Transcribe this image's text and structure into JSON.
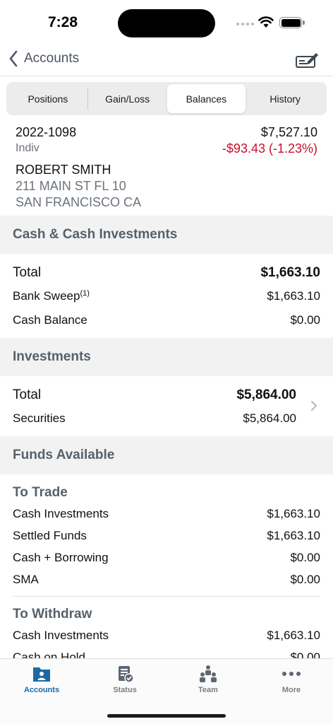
{
  "status": {
    "time": "7:28"
  },
  "nav": {
    "back_label": "Accounts"
  },
  "segments": [
    {
      "label": "Positions",
      "active": false
    },
    {
      "label": "Gain/Loss",
      "active": false
    },
    {
      "label": "Balances",
      "active": true
    },
    {
      "label": "History",
      "active": false
    }
  ],
  "account": {
    "number": "2022-1098",
    "type": "Indiv",
    "value": "$7,527.10",
    "change": "-$93.43 (-1.23%)",
    "owner": "ROBERT SMITH",
    "address_line1": "211 MAIN ST FL 10",
    "address_line2": "SAN FRANCISCO CA"
  },
  "cash": {
    "header": "Cash & Cash Investments",
    "total_label": "Total",
    "total_value": "$1,663.10",
    "bank_sweep_label": "Bank Sweep",
    "bank_sweep_note": "(1)",
    "bank_sweep_value": "$1,663.10",
    "cash_balance_label": "Cash Balance",
    "cash_balance_value": "$0.00"
  },
  "investments": {
    "header": "Investments",
    "total_label": "Total",
    "total_value": "$5,864.00",
    "securities_label": "Securities",
    "securities_value": "$5,864.00"
  },
  "funds": {
    "header": "Funds Available",
    "to_trade": {
      "title": "To Trade",
      "rows": [
        {
          "label": "Cash Investments",
          "value": "$1,663.10"
        },
        {
          "label": "Settled Funds",
          "value": "$1,663.10"
        },
        {
          "label": "Cash + Borrowing",
          "value": "$0.00"
        },
        {
          "label": "SMA",
          "value": "$0.00"
        }
      ]
    },
    "to_withdraw": {
      "title": "To Withdraw",
      "rows": [
        {
          "label": "Cash Investments",
          "value": "$1,663.10"
        },
        {
          "label": "Cash on Hold",
          "value": "$0.00"
        }
      ]
    }
  },
  "tabs": [
    {
      "label": "Accounts",
      "icon": "accounts-icon",
      "active": true
    },
    {
      "label": "Status",
      "icon": "status-icon",
      "active": false
    },
    {
      "label": "Team",
      "icon": "team-icon",
      "active": false
    },
    {
      "label": "More",
      "icon": "more-icon",
      "active": false
    }
  ],
  "colors": {
    "accent": "#1a6aa6",
    "negative": "#c8102e",
    "section_bg": "#f2f2f3"
  }
}
